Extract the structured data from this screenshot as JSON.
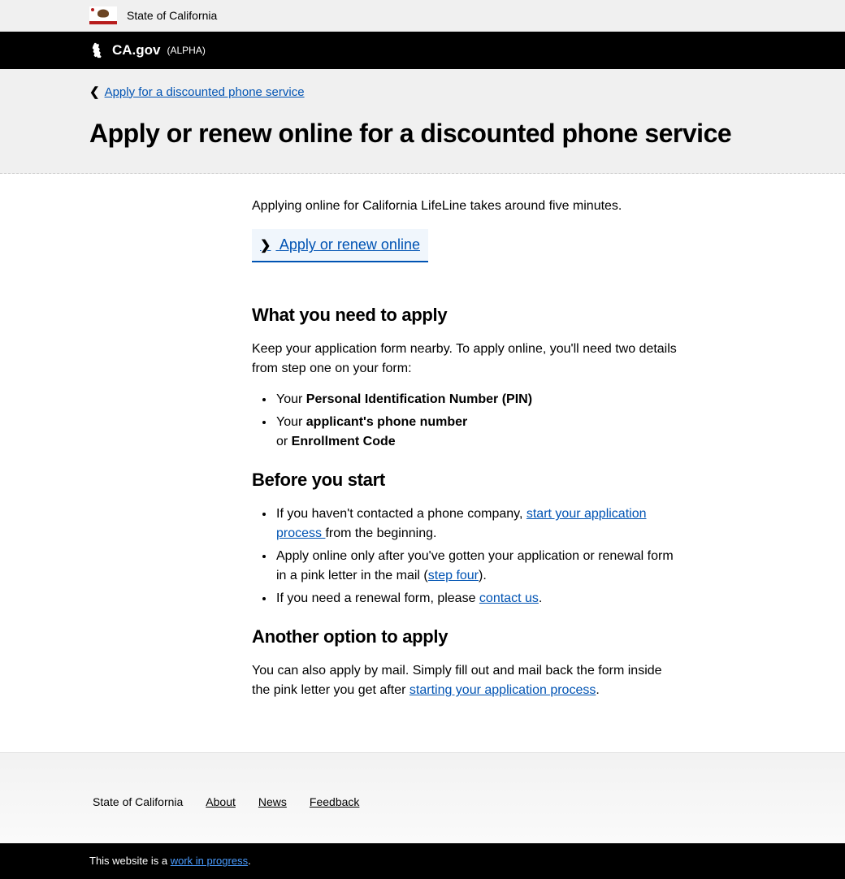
{
  "topbar": {
    "state_label": "State of California"
  },
  "brand": {
    "site": "CA.gov",
    "tag": "(ALPHA)"
  },
  "breadcrumb": {
    "label": "Apply for a discounted phone service"
  },
  "page": {
    "title": "Apply or renew online for a discounted phone service"
  },
  "intro": "Applying online for California LifeLine takes around five minutes.",
  "cta": {
    "label": "Apply or renew online"
  },
  "section_need": {
    "heading": "What you need to apply",
    "lead": "Keep your application form nearby. To apply online, you'll need two details from step one on your form:",
    "items": [
      {
        "prefix": "Your ",
        "bold": "Personal Identification Number (PIN)"
      },
      {
        "prefix": "Your ",
        "bold": "applicant's phone number",
        "line2_prefix": "or ",
        "line2_bold": "Enrollment Code"
      }
    ]
  },
  "section_before": {
    "heading": "Before you start",
    "items": [
      {
        "pre": "If you haven't contacted a phone company, ",
        "link": "start your application process ",
        "post": "from the beginning."
      },
      {
        "pre": "Apply online only after you've gotten your application or renewal form in a pink letter in the mail (",
        "link": "step four",
        "post": ")."
      },
      {
        "pre": "If you need a renewal form, please ",
        "link": "contact us",
        "post": "."
      }
    ]
  },
  "section_other": {
    "heading": "Another option to apply",
    "text_pre": "You can also apply by mail. Simply fill out and mail back the form inside the pink letter you get after ",
    "link": "starting your application process",
    "text_post": "."
  },
  "footer": {
    "state": "State of California",
    "links": [
      "About",
      "News",
      "Feedback"
    ],
    "wip_pre": "This website is a ",
    "wip_link": "work in progress",
    "wip_post": "."
  }
}
